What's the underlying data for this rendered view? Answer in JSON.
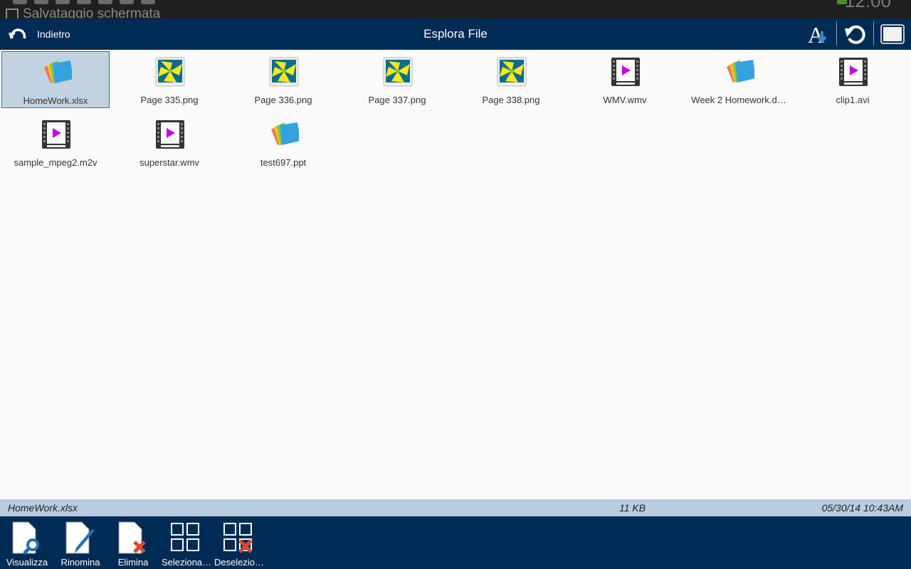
{
  "system_bar": {
    "notification": "Salvataggio schermata",
    "clock": "12:00"
  },
  "header": {
    "back_label": "Indietro",
    "title": "Esplora File",
    "icons": [
      "sort-az-icon",
      "refresh-icon",
      "window-icon"
    ]
  },
  "files": [
    {
      "name": "HomeWork.xlsx",
      "type": "office",
      "selected": true
    },
    {
      "name": "Page 335.png",
      "type": "image"
    },
    {
      "name": "Page 336.png",
      "type": "image"
    },
    {
      "name": "Page 337.png",
      "type": "image"
    },
    {
      "name": "Page 338.png",
      "type": "image"
    },
    {
      "name": "WMV.wmv",
      "type": "video"
    },
    {
      "name": "Week 2 Homework.d…",
      "type": "office"
    },
    {
      "name": "clip1.avi",
      "type": "video"
    },
    {
      "name": "sample_mpeg2.m2v",
      "type": "video"
    },
    {
      "name": "superstar.wmv",
      "type": "video"
    },
    {
      "name": "test697.ppt",
      "type": "office"
    }
  ],
  "info_bar": {
    "name": "HomeWork.xlsx",
    "size": "11 KB",
    "date": "05/30/14 10:43AM"
  },
  "toolbar": [
    {
      "label": "Visualizza",
      "icon": "view-file-icon"
    },
    {
      "label": "Rinomina",
      "icon": "rename-file-icon"
    },
    {
      "label": "Elimina",
      "icon": "delete-file-icon"
    },
    {
      "label": "Seleziona…",
      "icon": "select-all-icon"
    },
    {
      "label": "Deselezio…",
      "icon": "deselect-all-icon"
    }
  ]
}
